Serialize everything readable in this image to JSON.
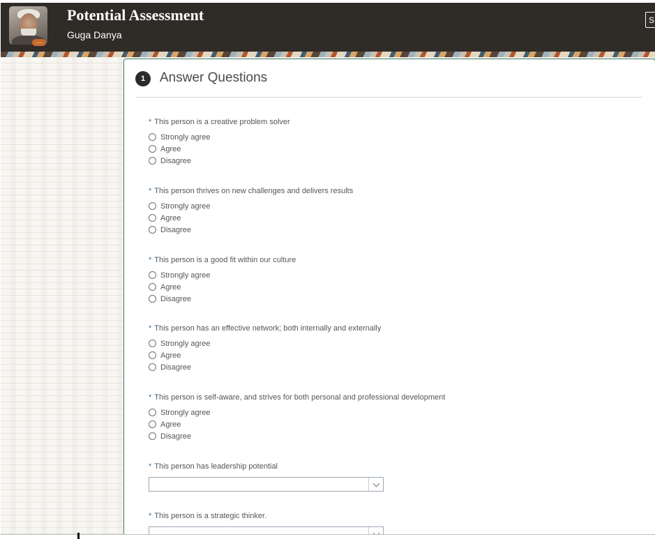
{
  "header": {
    "title": "Potential Assessment",
    "person_name": "Guga Danya",
    "avatar_badge": "...",
    "button_label": "S"
  },
  "section": {
    "step_number": "1",
    "title": "Answer Questions"
  },
  "required_marker": "*",
  "questions": [
    {
      "label": "This person is a creative problem solver",
      "type": "radio",
      "options": [
        "Strongly agree",
        "Agree",
        "Disagree"
      ]
    },
    {
      "label": "This person thrives on new challenges and delivers results",
      "type": "radio",
      "options": [
        "Strongly agree",
        "Agree",
        "Disagree"
      ]
    },
    {
      "label": "This person is a good fit within our culture",
      "type": "radio",
      "options": [
        "Strongly agree",
        "Agree",
        "Disagree"
      ]
    },
    {
      "label": "This person has an effective network; both internally and externally",
      "type": "radio",
      "options": [
        "Strongly agree",
        "Agree",
        "Disagree"
      ]
    },
    {
      "label": "This person is self-aware, and strives for both personal and professional development",
      "type": "radio",
      "options": [
        "Strongly agree",
        "Agree",
        "Disagree"
      ]
    },
    {
      "label": "This person has leadership potential",
      "type": "select",
      "value": ""
    },
    {
      "label": "This person is a strategic thinker.",
      "type": "select",
      "value": ""
    }
  ],
  "colors": {
    "header_bg": "#2f2b27",
    "panel_border": "#3d7a6c",
    "required_asterisk": "#2f6fae",
    "avatar_badge": "#c76a2c"
  }
}
